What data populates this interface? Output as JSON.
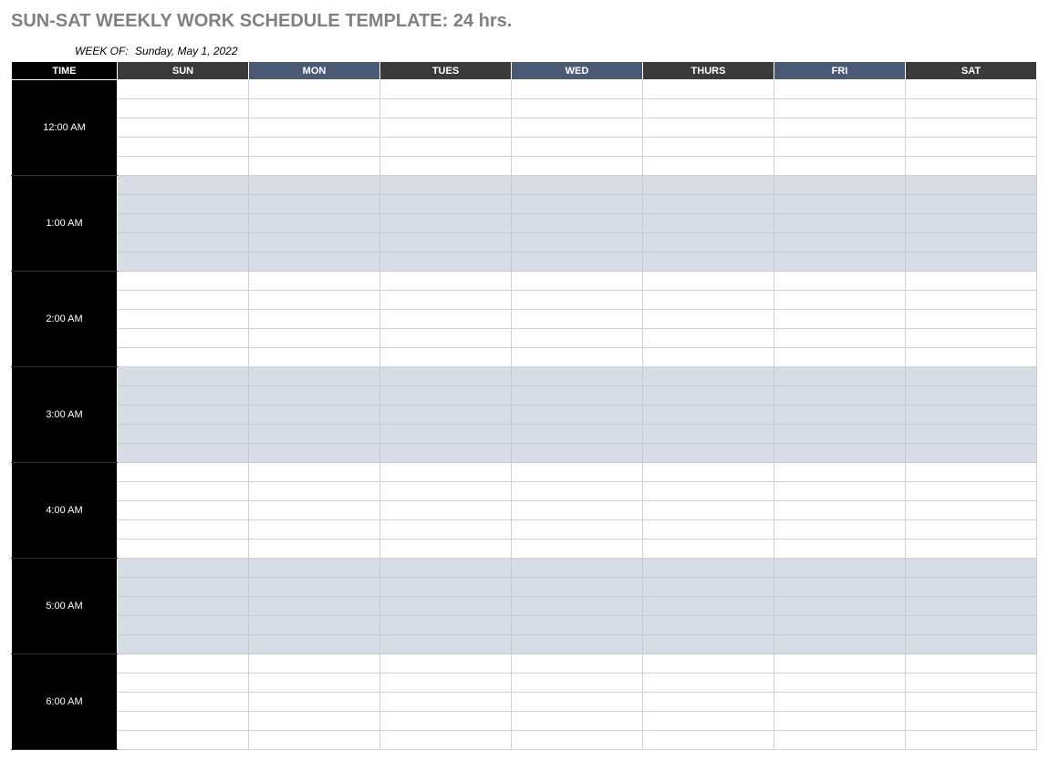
{
  "title": "SUN-SAT WEEKLY WORK SCHEDULE TEMPLATE: 24 hrs.",
  "week_of_label": "WEEK OF:",
  "week_of_date": "Sunday, May 1, 2022",
  "headers": {
    "time": "TIME",
    "days": [
      "SUN",
      "MON",
      "TUES",
      "WED",
      "THURS",
      "FRI",
      "SAT"
    ]
  },
  "time_slots": [
    {
      "label": "12:00 AM",
      "shade": "white"
    },
    {
      "label": "1:00 AM",
      "shade": "grey"
    },
    {
      "label": "2:00 AM",
      "shade": "white"
    },
    {
      "label": "3:00 AM",
      "shade": "grey"
    },
    {
      "label": "4:00 AM",
      "shade": "white"
    },
    {
      "label": "5:00 AM",
      "shade": "grey"
    },
    {
      "label": "6:00 AM",
      "shade": "white"
    }
  ],
  "rows_per_slot": 5
}
